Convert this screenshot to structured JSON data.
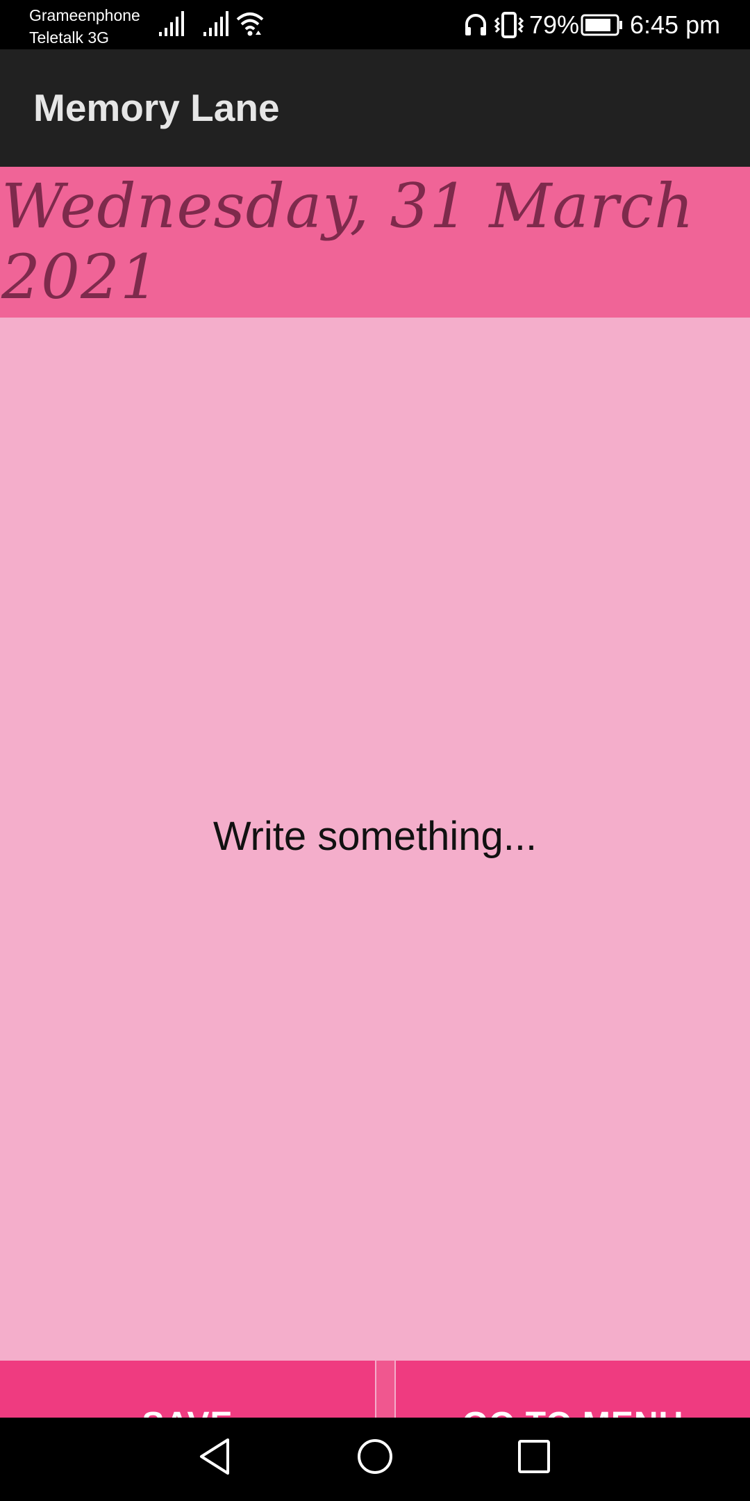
{
  "status_bar": {
    "carrier_1": "Grameenphone",
    "carrier_2": "Teletalk 3G",
    "battery_percent": "79%",
    "time": "6:45 pm",
    "icons": [
      "signal-icon",
      "signal-icon",
      "wifi-icon",
      "headset-icon",
      "vibrate-icon",
      "battery-icon"
    ]
  },
  "app_bar": {
    "title": "Memory Lane"
  },
  "entry": {
    "date": "Wednesday, 31 March 2021",
    "placeholder": "Write something..."
  },
  "buttons": {
    "save_label": "SAVE",
    "menu_label": "GO TO MENU"
  },
  "nav_bar": {
    "icons": [
      "back-icon",
      "home-icon",
      "recents-icon"
    ]
  },
  "colors": {
    "status_bar_bg": "#000000",
    "app_bar_bg": "#212121",
    "date_header_bg": "#f06497",
    "date_text": "#7e2a4c",
    "write_area_bg": "#f4aecb",
    "button_bg": "#ef3b80",
    "nav_bar_bg": "#000000"
  }
}
